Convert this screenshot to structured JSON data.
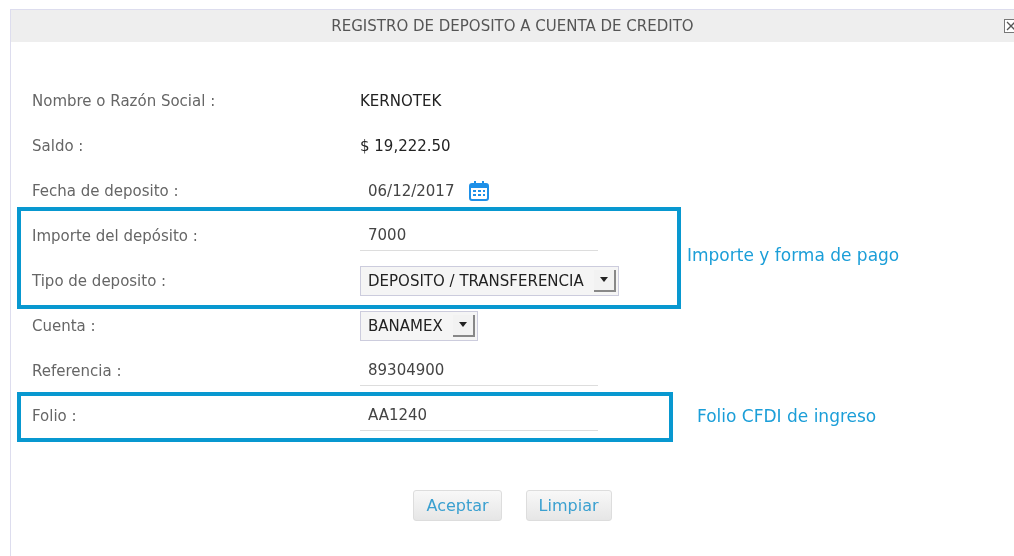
{
  "window": {
    "title": "REGISTRO DE DEPOSITO A CUENTA DE CREDITO"
  },
  "fields": [
    {
      "kind": "text",
      "label": "Nombre o Razón Social :",
      "value": "KERNOTEK"
    },
    {
      "kind": "text",
      "label": "Saldo :",
      "value": "$ 19,222.50"
    },
    {
      "kind": "date",
      "label": "Fecha de deposito :",
      "value": "06/12/2017"
    },
    {
      "kind": "input",
      "label": "Importe del depósito :",
      "value": "7000"
    },
    {
      "kind": "select",
      "label": "Tipo de deposito :",
      "value": "DEPOSITO / TRANSFERENCIA"
    },
    {
      "kind": "select",
      "label": "Cuenta :",
      "value": "BANAMEX"
    },
    {
      "kind": "input",
      "label": "Referencia :",
      "value": "89304900"
    },
    {
      "kind": "input",
      "label": "Folio :",
      "value": "AA1240"
    }
  ],
  "annotations": [
    {
      "text": "Importe y forma de pago"
    },
    {
      "text": "Folio CFDI de ingreso"
    }
  ],
  "buttons": [
    "Aceptar",
    "Limpiar"
  ]
}
